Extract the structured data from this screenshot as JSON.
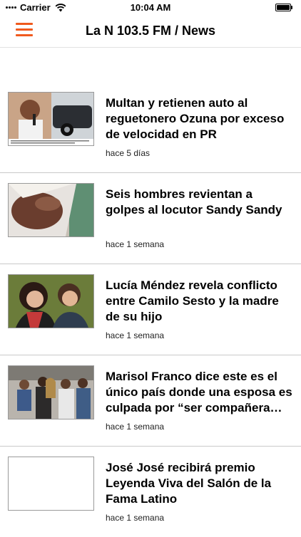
{
  "status_bar": {
    "carrier": "Carrier",
    "time": "10:04 AM"
  },
  "header": {
    "title": "La N 103.5 FM / News",
    "menu_icon": "hamburger-menu-icon",
    "accent_color": "#f05a1e"
  },
  "news": [
    {
      "headline": "Multan y retienen auto al reguetonero Ozuna por exceso de velocidad en PR",
      "time_ago": "hace 5 días"
    },
    {
      "headline": "Seis hombres revientan a golpes al locutor Sandy Sandy",
      "time_ago": "hace 1 semana"
    },
    {
      "headline": "Lucía Méndez revela conflicto entre Camilo Sesto y la madre de su hijo",
      "time_ago": "hace 1 semana"
    },
    {
      "headline": "Marisol Franco dice este es el único país donde una esposa es culpada por “ser compañera se…",
      "time_ago": "hace 1 semana"
    },
    {
      "headline": "José José recibirá premio Leyenda Viva del Salón de la Fama Latino",
      "time_ago": "hace 1 semana"
    }
  ]
}
